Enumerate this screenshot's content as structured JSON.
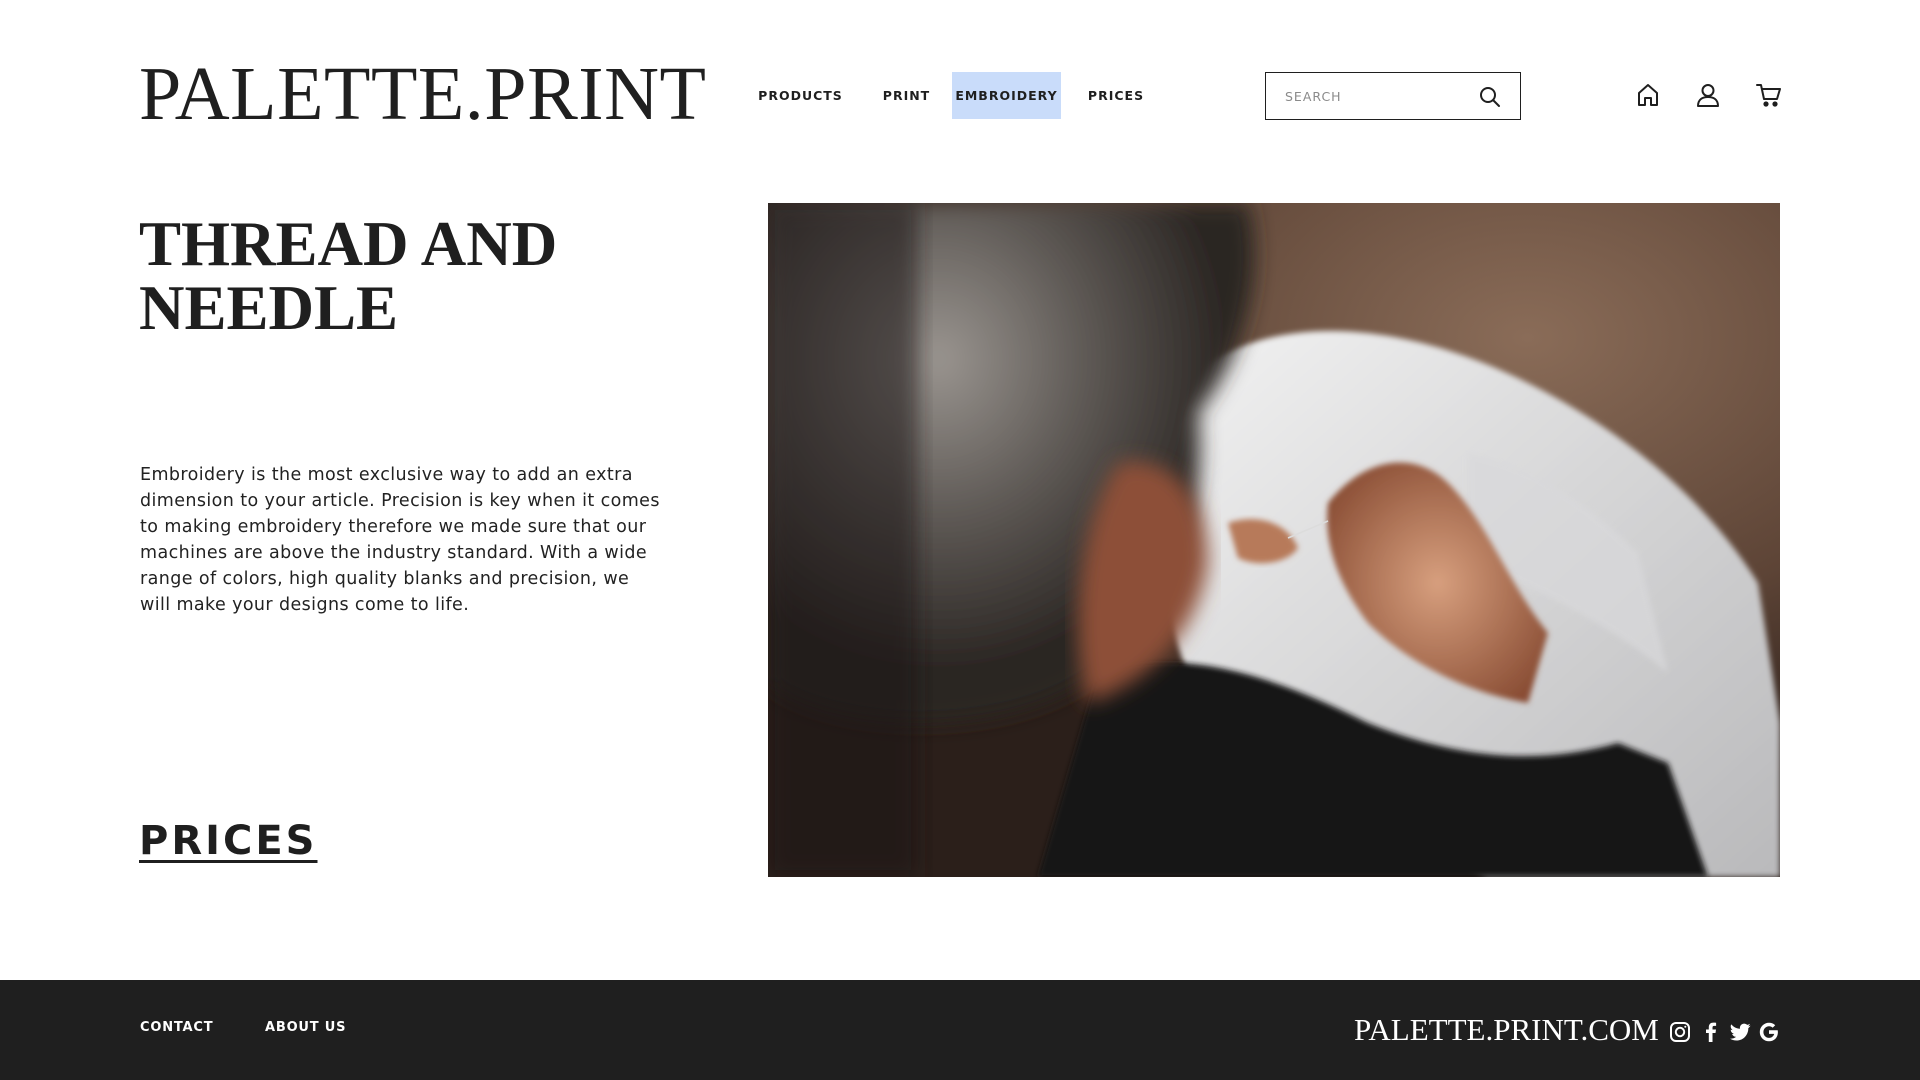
{
  "brand": {
    "logo_text": "PALETTE.PRINT"
  },
  "nav": {
    "items": [
      {
        "label": "PRODUCTS"
      },
      {
        "label": "PRINT"
      },
      {
        "label": "EMBROIDERY",
        "active": true
      },
      {
        "label": "PRICES"
      }
    ]
  },
  "search": {
    "placeholder": "SEARCH",
    "value": ""
  },
  "header_icons": [
    "home-icon",
    "user-icon",
    "cart-icon"
  ],
  "hero": {
    "title": "THREAD AND NEEDLE",
    "body": "Embroidery is the most exclusive way to add an extra dimension to your article. Precision is key when it comes to making embroidery therefore we made sure that our machines are above the industry standard. With a wide range of colors, high quality blanks and precision, we will make your designs come to life.",
    "cta": "PRICES"
  },
  "footer": {
    "links": [
      "CONTACT",
      "ABOUT US"
    ],
    "domain": "PALETTE.PRINT.COM",
    "social_icons": [
      "instagram-icon",
      "facebook-icon",
      "twitter-icon",
      "google-icon"
    ]
  },
  "colors": {
    "text": "#1f1f1f",
    "nav_active_bg": "#c9dcfa",
    "footer_bg": "#1f1f1f",
    "footer_text": "#ffffff"
  }
}
